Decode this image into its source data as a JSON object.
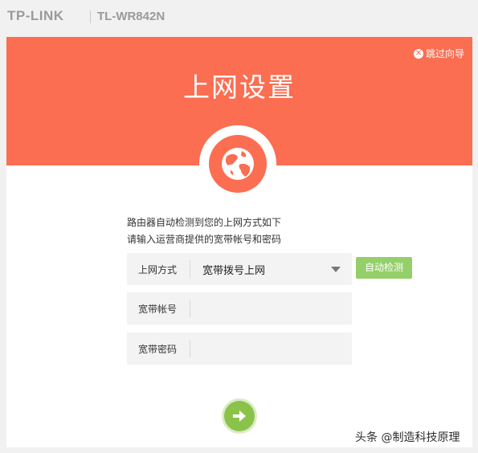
{
  "header": {
    "brand": "TP-LINK",
    "model": "TL-WR842N"
  },
  "banner": {
    "skip_label": "跳过向导",
    "title": "上网设置"
  },
  "description": {
    "line1": "路由器自动检测到您的上网方式如下",
    "line2": "请输入运营商提供的宽带帐号和密码"
  },
  "form": {
    "connection_type": {
      "label": "上网方式",
      "value": "宽带拨号上网"
    },
    "account": {
      "label": "宽带帐号",
      "value": ""
    },
    "password": {
      "label": "宽带密码",
      "value": ""
    },
    "auto_detect_label": "自动检测"
  },
  "watermark": "头条 @制造科技原理",
  "colors": {
    "accent": "#fb6e52",
    "green": "#8bc34a"
  },
  "icons": {
    "globe": "globe-icon",
    "next": "arrow-right-icon",
    "skip": "close-circle-icon"
  }
}
